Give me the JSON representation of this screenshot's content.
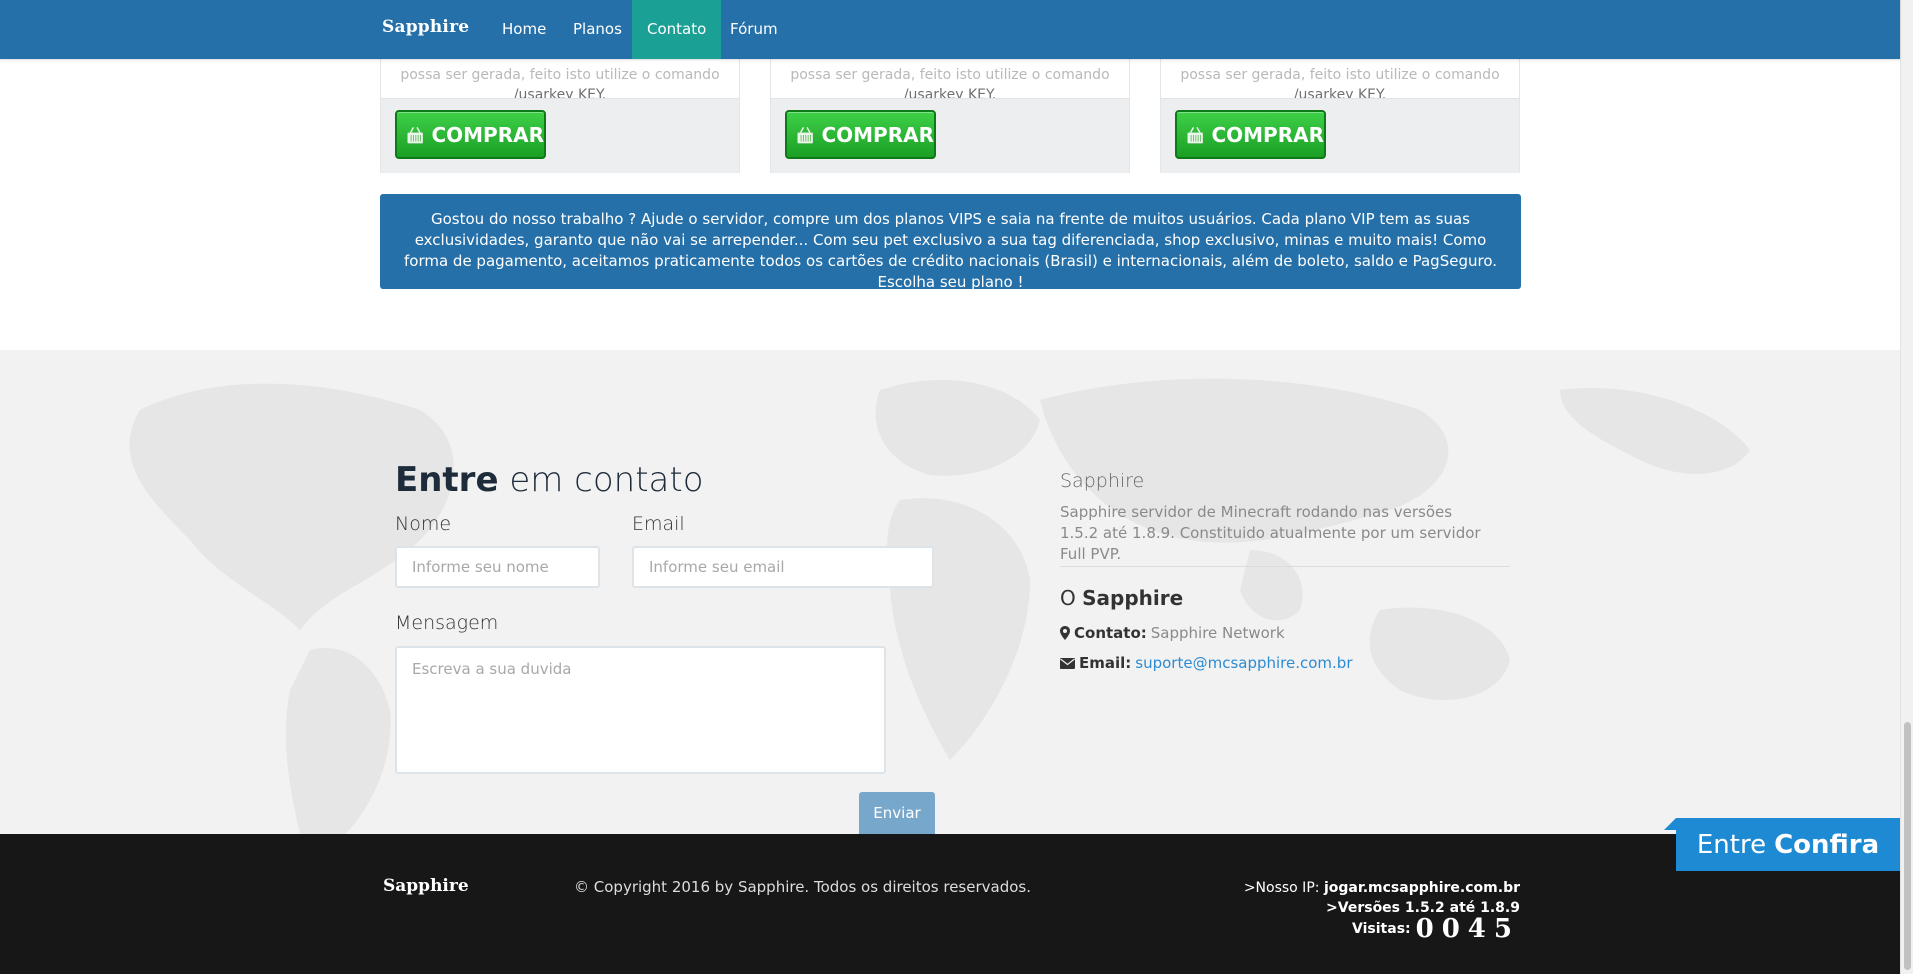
{
  "nav": {
    "brand": "Sapphire",
    "items": [
      {
        "label": "Home"
      },
      {
        "label": "Planos"
      },
      {
        "label": "Contato"
      },
      {
        "label": "Fórum"
      }
    ]
  },
  "plans": [
    {
      "text_cut": "possa ser gerada, feito isto utilize o comando",
      "text": "/usarkey KEY.",
      "buy_label": "COMPRAR"
    },
    {
      "text_cut": "possa ser gerada, feito isto utilize o comando",
      "text": "/usarkey KEY.",
      "buy_label": "COMPRAR"
    },
    {
      "text_cut": "possa ser gerada, feito isto utilize o comando",
      "text": "/usarkey KEY.",
      "buy_label": "COMPRAR"
    }
  ],
  "banner": {
    "text": "Gostou do nosso trabalho ? Ajude o servidor, compre um dos planos VIPS e saia na frente de muitos usuários. Cada plano VIP tem as suas exclusividades, garanto que não vai se arrepender... Com seu pet exclusivo a sua tag diferenciada, shop exclusivo, minas e muito mais! Como forma de pagamento, aceitamos praticamente todos os cartões de crédito nacionais (Brasil) e internacionais, além de boleto, saldo e PagSeguro. Escolha seu plano !"
  },
  "contact": {
    "title_bold": "Entre",
    "title_rest": " em contato",
    "name_label": "Nome",
    "name_placeholder": "Informe seu nome",
    "email_label": "Email",
    "email_placeholder": "Informe seu email",
    "message_label": "Mensagem",
    "message_placeholder": "Escreva a sua duvida",
    "send_label": "Enviar"
  },
  "about": {
    "title": "Sapphire",
    "text": "Sapphire servidor de Minecraft rodando nas versões 1.5.2 até 1.8.9. Constituido atualmente por um servidor Full PVP.",
    "o_prefix": "O ",
    "o_name": "Sapphire",
    "contact_key": "Contato:",
    "contact_value": "Sapphire Network",
    "email_key": "Email:",
    "email_value": "suporte@mcsapphire.com.br"
  },
  "footer": {
    "brand": "Sapphire",
    "copyright": "© Copyright 2016 by Sapphire. Todos os direitos reservados.",
    "ip_label": ">Nosso IP: ",
    "ip_value": "jogar.mcsapphire.com.br",
    "versions": ">Versões 1.5.2 até 1.8.9",
    "visits_label": "Visitas:",
    "visits_value": "0045"
  },
  "chat": {
    "label_light": "Entre",
    "label_bold": "Confira"
  },
  "colors": {
    "navbar": "#2570a9",
    "nav_active": "#1aa094",
    "buy_green": "#1aa024",
    "banner": "#2570a9",
    "send_button": "#78a7cc",
    "footer": "#171717",
    "chat_tab": "#1e8ad3",
    "link": "#2d8bd0"
  }
}
